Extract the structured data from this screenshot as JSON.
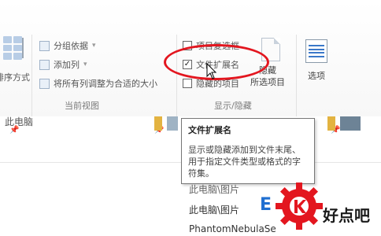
{
  "ribbon": {
    "sort_label": "排序方式",
    "group_by_label": "分组依据",
    "add_column_label": "添加列",
    "fit_columns_label": "将所有列调整为合适的大小",
    "current_view_label": "当前视图",
    "item_checkboxes_label": "项目复选框",
    "file_extensions_label": "文件扩展名",
    "file_extensions_checked": true,
    "hidden_items_label": "隐藏的项目",
    "hide_selected_line1": "隐藏",
    "hide_selected_line2": "所选项目",
    "show_hide_label": "显示/隐藏",
    "options_label": "选项"
  },
  "nav": {
    "item_left": "此电脑"
  },
  "list": {
    "row1": "此电脑\\图片",
    "row2": "此电脑\\图片",
    "row3": "PhantomNebulaSe"
  },
  "tooltip": {
    "title": "文件扩展名",
    "description": "显示或隐藏添加到文件末尾、用于指定文件类型或格式的字符集。"
  },
  "watermark": {
    "text": "好点吧"
  },
  "colors": {
    "highlight_ellipse": "#e3161f",
    "accent_blue": "#1f6fd1"
  }
}
